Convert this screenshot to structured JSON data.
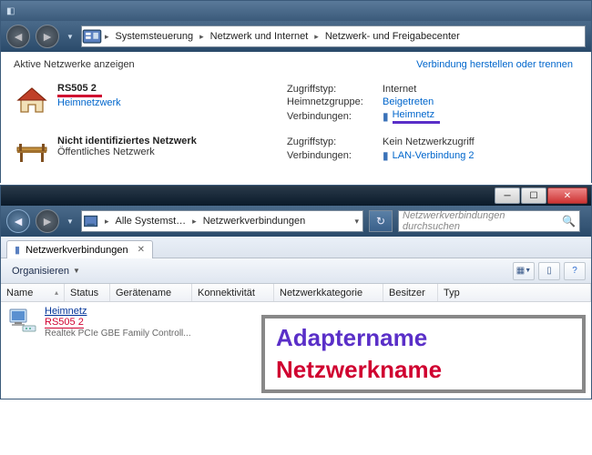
{
  "win1": {
    "breadcrumb": [
      "Systemsteuerung",
      "Netzwerk und Internet",
      "Netzwerk- und Freigabecenter"
    ],
    "header_left": "Aktive Netzwerke anzeigen",
    "header_right": "Verbindung herstellen oder trennen",
    "networks": [
      {
        "title": "RS505 2",
        "type_label": "Heimnetzwerk",
        "rows": [
          {
            "k": "Zugriffstyp:",
            "v": "Internet",
            "link": false,
            "icon": false
          },
          {
            "k": "Heimnetzgruppe:",
            "v": "Beigetreten",
            "link": true,
            "icon": false
          },
          {
            "k": "Verbindungen:",
            "v": "Heimnetz",
            "link": true,
            "icon": true,
            "highlight": "purple"
          }
        ]
      },
      {
        "title": "Nicht identifiziertes Netzwerk",
        "type_label": "Öffentliches Netzwerk",
        "rows": [
          {
            "k": "Zugriffstyp:",
            "v": "Kein Netzwerkzugriff",
            "link": false,
            "icon": false
          },
          {
            "k": "Verbindungen:",
            "v": "LAN-Verbindung 2",
            "link": true,
            "icon": true
          }
        ]
      }
    ]
  },
  "win2": {
    "breadcrumb": [
      "Alle Systemst…",
      "Netzwerkverbindungen"
    ],
    "search_placeholder": "Netzwerkverbindungen durchsuchen",
    "tab_label": "Netzwerkverbindungen",
    "toolbar_organise": "Organisieren",
    "columns": [
      "Name",
      "Status",
      "Gerätename",
      "Konnektivität",
      "Netzwerkkategorie",
      "Besitzer",
      "Typ"
    ],
    "item": {
      "name": "Heimnetz",
      "network": "RS505  2",
      "device": "Realtek PCIe GBE Family Controll..."
    },
    "annotation": {
      "line1": "Adaptername",
      "line2": "Netzwerkname"
    }
  }
}
